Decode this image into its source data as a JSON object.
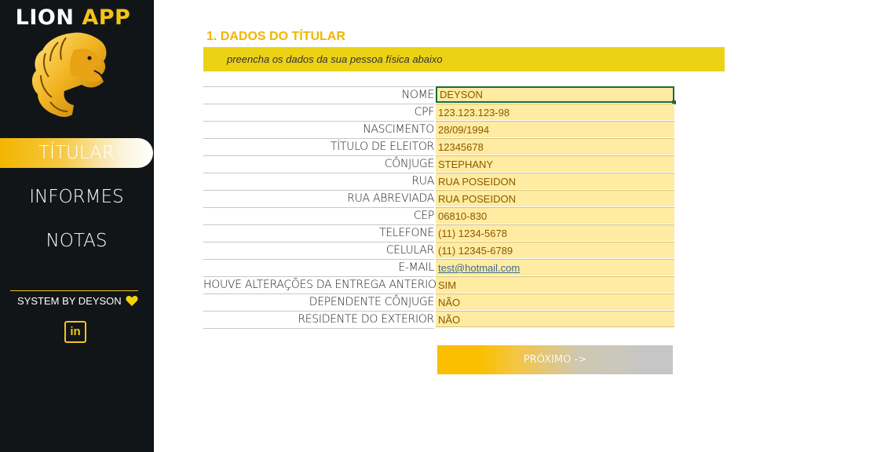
{
  "colors": {
    "sidebar_bg": "#121518",
    "accent_gold": "#f3c419",
    "subtitle_bar": "#ecd214",
    "input_fill": "#ffeba1",
    "selection_green": "#1c6b3b"
  },
  "sidebar": {
    "app_title_part1": "LION ",
    "app_title_part2": "APP",
    "logo_icon": "lion-head-icon",
    "nav": [
      {
        "label": "TÍTULAR",
        "active": true
      },
      {
        "label": "INFORMES",
        "active": false
      },
      {
        "label": "NOTAS",
        "active": false
      }
    ],
    "credit": "SYSTEM BY DEYSON",
    "credit_icon": "heart-icon",
    "social_icon": "linkedin-icon",
    "social_label": "in"
  },
  "main": {
    "section_title": "1. DADOS DO TÍTULAR",
    "subtitle": "preencha os dados da sua pessoa física abaixo",
    "fields": [
      {
        "label": "NOME",
        "value": "DEYSON"
      },
      {
        "label": "CPF",
        "value": "123.123.123-98"
      },
      {
        "label": "NASCIMENTO",
        "value": "28/09/1994"
      },
      {
        "label": "TÍTULO DE ELEITOR",
        "value": "12345678"
      },
      {
        "label": "CÔNJUGE",
        "value": "STEPHANY"
      },
      {
        "label": "RUA",
        "value": "RUA POSEIDON"
      },
      {
        "label": "RUA ABREVIADA",
        "value": "RUA POSEIDON"
      },
      {
        "label": "CEP",
        "value": "06810-830"
      },
      {
        "label": "TELEFONE",
        "value": "(11) 1234-5678"
      },
      {
        "label": "CELULAR",
        "value": "(11) 12345-6789"
      },
      {
        "label": "E-MAIL",
        "value": "test@hotmail.com"
      },
      {
        "label": "HOUVE ALTERAÇÕES DA ENTREGA ANTERIOR",
        "value": "SIM"
      },
      {
        "label": "DEPENDENTE CÔNJUGE",
        "value": "NÃO"
      },
      {
        "label": "RESIDENTE DO EXTERIOR",
        "value": "NÃO"
      }
    ],
    "next_button": "PRÓXIMO ->"
  }
}
